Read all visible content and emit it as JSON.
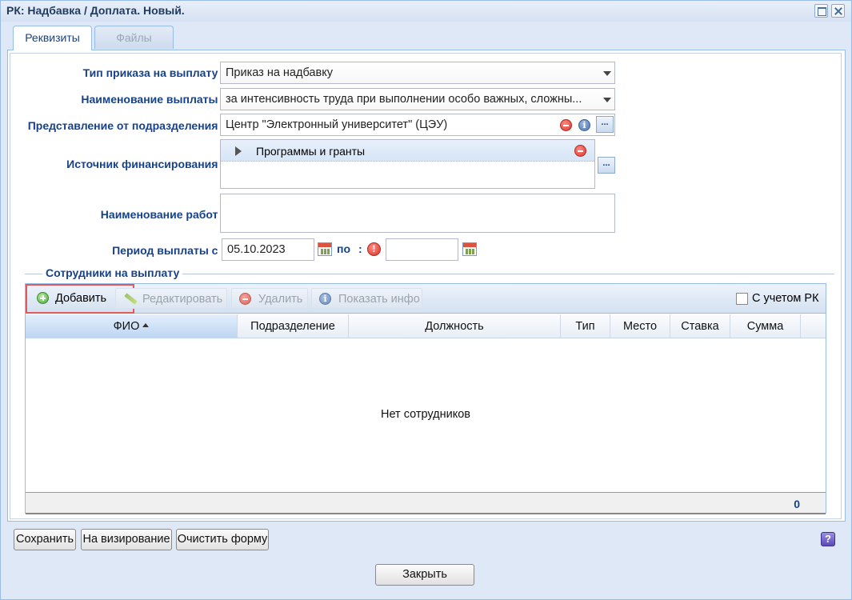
{
  "window": {
    "title": "РК: Надбавка / Доплата. Новый."
  },
  "tabs": [
    {
      "label": "Реквизиты",
      "active": true
    },
    {
      "label": "Файлы",
      "active": false
    }
  ],
  "form": {
    "order_type": {
      "label": "Тип приказа на выплату :",
      "value": "Приказ на надбавку"
    },
    "payment_name": {
      "label": "Наименование выплаты :",
      "value": "за интенсивность труда при выполнении особо важных, сложны..."
    },
    "department": {
      "label": "Представление от подразделения :",
      "value": "Центр \"Электронный университет\" (ЦЭУ)",
      "dots": "..."
    },
    "funding": {
      "label": "Источник финансирования :",
      "items": [
        "Программы и гранты"
      ],
      "dots": "..."
    },
    "works": {
      "label": "Наименование работ :",
      "value": ""
    },
    "period": {
      "label": "Период выплаты с :",
      "from": "05.10.2023",
      "to_label": "по",
      "to_sep": ":",
      "to": "",
      "warn_glyph": "!"
    }
  },
  "employees": {
    "title": "Сотрудники на выплату",
    "toolbar": {
      "add": "Добавить",
      "edit": "Редактировать",
      "delete": "Удалить",
      "info": "Показать инфо",
      "info_glyph": "i",
      "rk_checkbox": "С учетом РК",
      "rk_checked": false
    },
    "columns": [
      "ФИО",
      "Подразделение",
      "Должность",
      "Тип",
      "Место",
      "Ставка",
      "Сумма"
    ],
    "sorted_column": "ФИО",
    "rows": [],
    "empty_text": "Нет сотрудников",
    "total": "0"
  },
  "buttons": {
    "save": "Сохранить",
    "approve": "На визирование",
    "clear": "Очистить форму",
    "close": "Закрыть",
    "help": "?"
  },
  "icons": [
    "maximize-icon",
    "close-icon",
    "dropdown-arrow-icon",
    "remove-icon",
    "info-icon",
    "expand-arrow-icon",
    "calendar-icon",
    "warning-icon",
    "add-icon",
    "pencil-icon",
    "help-icon"
  ]
}
